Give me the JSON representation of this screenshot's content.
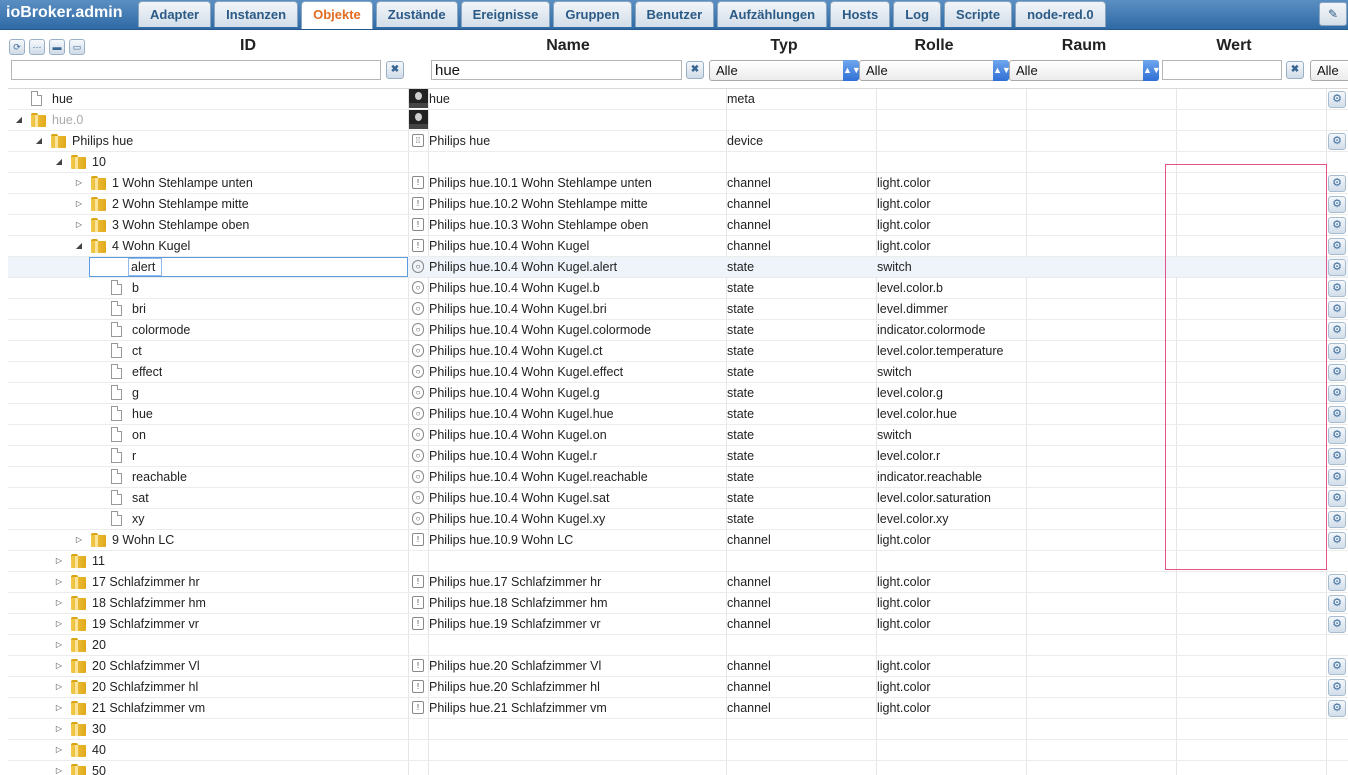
{
  "app": {
    "title": "ioBroker.admin"
  },
  "tabs": [
    "Adapter",
    "Instanzen",
    "Objekte",
    "Zustände",
    "Ereignisse",
    "Gruppen",
    "Benutzer",
    "Aufzählungen",
    "Hosts",
    "Log",
    "Scripte",
    "node-red.0"
  ],
  "active_tab": "Objekte",
  "columns": {
    "id": "ID",
    "name": "Name",
    "typ": "Typ",
    "rolle": "Rolle",
    "raum": "Raum",
    "wert": "Wert"
  },
  "filters": {
    "id_value": "",
    "name_value": "hue",
    "wert_value": "",
    "typ_selected": "Alle",
    "rolle_selected": "Alle",
    "raum_selected": "Alle",
    "last_selected": "Alle"
  },
  "icons": {
    "toolbar": [
      "refresh-icon",
      "collapse-all-icon",
      "folder-icon",
      "folder-open-icon"
    ],
    "clear": "close-icon",
    "setting": "gear-icon"
  },
  "rows": [
    {
      "depth": 0,
      "toggle": "",
      "kind": "file",
      "id": "hue",
      "icon": "logo",
      "name": "hue",
      "typ": "meta",
      "rolle": "",
      "gear": true,
      "grey": false
    },
    {
      "depth": 0,
      "toggle": "open",
      "kind": "folder",
      "id": "hue.0",
      "icon": "logo",
      "name": "",
      "typ": "",
      "rolle": "",
      "gear": false,
      "grey": true
    },
    {
      "depth": 1,
      "toggle": "open",
      "kind": "folder",
      "id": "Philips hue",
      "icon": "device",
      "name": "Philips hue",
      "typ": "device",
      "rolle": "",
      "gear": true,
      "grey": false
    },
    {
      "depth": 2,
      "toggle": "open",
      "kind": "folder",
      "id": "10",
      "icon": "",
      "name": "",
      "typ": "",
      "rolle": "",
      "gear": false,
      "grey": false
    },
    {
      "depth": 3,
      "toggle": "closed",
      "kind": "folder",
      "id": "1 Wohn Stehlampe unten",
      "icon": "channel",
      "name": "Philips hue.10.1 Wohn Stehlampe unten",
      "typ": "channel",
      "rolle": "light.color",
      "gear": true,
      "grey": false
    },
    {
      "depth": 3,
      "toggle": "closed",
      "kind": "folder",
      "id": "2 Wohn Stehlampe mitte",
      "icon": "channel",
      "name": "Philips hue.10.2 Wohn Stehlampe mitte",
      "typ": "channel",
      "rolle": "light.color",
      "gear": true,
      "grey": false
    },
    {
      "depth": 3,
      "toggle": "closed",
      "kind": "folder",
      "id": "3 Wohn Stehlampe oben",
      "icon": "channel",
      "name": "Philips hue.10.3 Wohn Stehlampe oben",
      "typ": "channel",
      "rolle": "light.color",
      "gear": true,
      "grey": false
    },
    {
      "depth": 3,
      "toggle": "open",
      "kind": "folder",
      "id": "4 Wohn Kugel",
      "icon": "channel",
      "name": "Philips hue.10.4 Wohn Kugel",
      "typ": "channel",
      "rolle": "light.color",
      "gear": true,
      "grey": false
    },
    {
      "depth": 4,
      "toggle": "",
      "kind": "file",
      "id": "alert",
      "icon": "state",
      "name": "Philips hue.10.4 Wohn Kugel.alert",
      "typ": "state",
      "rolle": "switch",
      "gear": true,
      "grey": false,
      "editing": true
    },
    {
      "depth": 4,
      "toggle": "",
      "kind": "file",
      "id": "b",
      "icon": "state",
      "name": "Philips hue.10.4 Wohn Kugel.b",
      "typ": "state",
      "rolle": "level.color.b",
      "gear": true,
      "grey": false
    },
    {
      "depth": 4,
      "toggle": "",
      "kind": "file",
      "id": "bri",
      "icon": "state",
      "name": "Philips hue.10.4 Wohn Kugel.bri",
      "typ": "state",
      "rolle": "level.dimmer",
      "gear": true,
      "grey": false
    },
    {
      "depth": 4,
      "toggle": "",
      "kind": "file",
      "id": "colormode",
      "icon": "state",
      "name": "Philips hue.10.4 Wohn Kugel.colormode",
      "typ": "state",
      "rolle": "indicator.colormode",
      "gear": true,
      "grey": false
    },
    {
      "depth": 4,
      "toggle": "",
      "kind": "file",
      "id": "ct",
      "icon": "state",
      "name": "Philips hue.10.4 Wohn Kugel.ct",
      "typ": "state",
      "rolle": "level.color.temperature",
      "gear": true,
      "grey": false
    },
    {
      "depth": 4,
      "toggle": "",
      "kind": "file",
      "id": "effect",
      "icon": "state",
      "name": "Philips hue.10.4 Wohn Kugel.effect",
      "typ": "state",
      "rolle": "switch",
      "gear": true,
      "grey": false
    },
    {
      "depth": 4,
      "toggle": "",
      "kind": "file",
      "id": "g",
      "icon": "state",
      "name": "Philips hue.10.4 Wohn Kugel.g",
      "typ": "state",
      "rolle": "level.color.g",
      "gear": true,
      "grey": false
    },
    {
      "depth": 4,
      "toggle": "",
      "kind": "file",
      "id": "hue",
      "icon": "state",
      "name": "Philips hue.10.4 Wohn Kugel.hue",
      "typ": "state",
      "rolle": "level.color.hue",
      "gear": true,
      "grey": false
    },
    {
      "depth": 4,
      "toggle": "",
      "kind": "file",
      "id": "on",
      "icon": "state",
      "name": "Philips hue.10.4 Wohn Kugel.on",
      "typ": "state",
      "rolle": "switch",
      "gear": true,
      "grey": false
    },
    {
      "depth": 4,
      "toggle": "",
      "kind": "file",
      "id": "r",
      "icon": "state",
      "name": "Philips hue.10.4 Wohn Kugel.r",
      "typ": "state",
      "rolle": "level.color.r",
      "gear": true,
      "grey": false
    },
    {
      "depth": 4,
      "toggle": "",
      "kind": "file",
      "id": "reachable",
      "icon": "state",
      "name": "Philips hue.10.4 Wohn Kugel.reachable",
      "typ": "state",
      "rolle": "indicator.reachable",
      "gear": true,
      "grey": false
    },
    {
      "depth": 4,
      "toggle": "",
      "kind": "file",
      "id": "sat",
      "icon": "state",
      "name": "Philips hue.10.4 Wohn Kugel.sat",
      "typ": "state",
      "rolle": "level.color.saturation",
      "gear": true,
      "grey": false
    },
    {
      "depth": 4,
      "toggle": "",
      "kind": "file",
      "id": "xy",
      "icon": "state",
      "name": "Philips hue.10.4 Wohn Kugel.xy",
      "typ": "state",
      "rolle": "level.color.xy",
      "gear": true,
      "grey": false
    },
    {
      "depth": 3,
      "toggle": "closed",
      "kind": "folder",
      "id": "9 Wohn LC",
      "icon": "channel",
      "name": "Philips hue.10.9 Wohn LC",
      "typ": "channel",
      "rolle": "light.color",
      "gear": true,
      "grey": false
    },
    {
      "depth": 2,
      "toggle": "closed",
      "kind": "folder",
      "id": "11",
      "icon": "",
      "name": "",
      "typ": "",
      "rolle": "",
      "gear": false,
      "grey": false
    },
    {
      "depth": 2,
      "toggle": "closed",
      "kind": "folder",
      "id": "17 Schlafzimmer hr",
      "icon": "channel",
      "name": "Philips hue.17 Schlafzimmer hr",
      "typ": "channel",
      "rolle": "light.color",
      "gear": true,
      "grey": false
    },
    {
      "depth": 2,
      "toggle": "closed",
      "kind": "folder",
      "id": "18 Schlafzimmer hm",
      "icon": "channel",
      "name": "Philips hue.18 Schlafzimmer hm",
      "typ": "channel",
      "rolle": "light.color",
      "gear": true,
      "grey": false
    },
    {
      "depth": 2,
      "toggle": "closed",
      "kind": "folder",
      "id": "19 Schlafzimmer vr",
      "icon": "channel",
      "name": "Philips hue.19 Schlafzimmer vr",
      "typ": "channel",
      "rolle": "light.color",
      "gear": true,
      "grey": false
    },
    {
      "depth": 2,
      "toggle": "closed",
      "kind": "folder",
      "id": "20",
      "icon": "",
      "name": "",
      "typ": "",
      "rolle": "",
      "gear": false,
      "grey": false
    },
    {
      "depth": 2,
      "toggle": "closed",
      "kind": "folder",
      "id": "20 Schlafzimmer Vl",
      "icon": "channel",
      "name": "Philips hue.20 Schlafzimmer Vl",
      "typ": "channel",
      "rolle": "light.color",
      "gear": true,
      "grey": false
    },
    {
      "depth": 2,
      "toggle": "closed",
      "kind": "folder",
      "id": "20 Schlafzimmer hl",
      "icon": "channel",
      "name": "Philips hue.20 Schlafzimmer hl",
      "typ": "channel",
      "rolle": "light.color",
      "gear": true,
      "grey": false
    },
    {
      "depth": 2,
      "toggle": "closed",
      "kind": "folder",
      "id": "21 Schlafzimmer vm",
      "icon": "channel",
      "name": "Philips hue.21 Schlafzimmer vm",
      "typ": "channel",
      "rolle": "light.color",
      "gear": true,
      "grey": false
    },
    {
      "depth": 2,
      "toggle": "closed",
      "kind": "folder",
      "id": "30",
      "icon": "",
      "name": "",
      "typ": "",
      "rolle": "",
      "gear": false,
      "grey": false
    },
    {
      "depth": 2,
      "toggle": "closed",
      "kind": "folder",
      "id": "40",
      "icon": "",
      "name": "",
      "typ": "",
      "rolle": "",
      "gear": false,
      "grey": false
    },
    {
      "depth": 2,
      "toggle": "closed",
      "kind": "folder",
      "id": "50",
      "icon": "",
      "name": "",
      "typ": "",
      "rolle": "",
      "gear": false,
      "grey": false
    }
  ],
  "colors": {
    "accent_tab": "#e16c22",
    "header": "#2f6aa5",
    "highlight": "#e4538a"
  }
}
